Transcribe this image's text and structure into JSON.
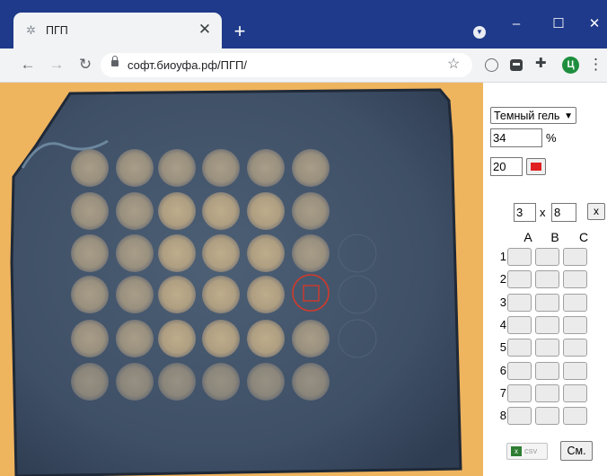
{
  "browser": {
    "tab_title": "ПГП",
    "tab_favicon": "settings-gear-icon",
    "url": "софт.биоуфа.рф/ПГП/",
    "profile_initial": "Ц",
    "window_controls": [
      "–",
      "☐",
      "✕"
    ],
    "accent_color": "#1f3a8a"
  },
  "panel": {
    "mode_select": "Темный гель",
    "percent_value": "34",
    "percent_unit": "%",
    "size_value": "20",
    "marker_color": "#e02020",
    "grid_rows": "3",
    "grid_cols": "8",
    "grid_sep": "x",
    "clear_label": "x",
    "column_headers": [
      "A",
      "B",
      "C"
    ],
    "row_labels": [
      "1",
      "2",
      "3",
      "4",
      "5",
      "6",
      "7",
      "8"
    ],
    "csv_label": "csv",
    "see_label": "См."
  },
  "gel": {
    "well_rows": 6,
    "well_cols": 6,
    "selection_color": "#d23a2a"
  }
}
